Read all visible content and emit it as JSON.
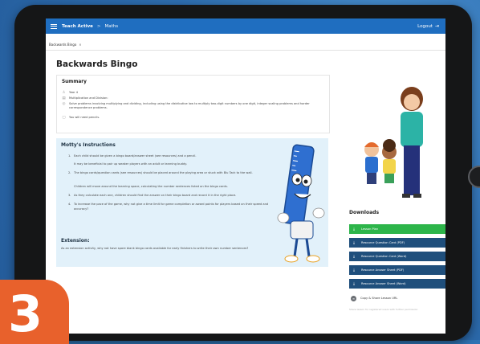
{
  "nav": {
    "brand": "Teach Active",
    "separator": ">",
    "crumb": "Maths",
    "logout_label": "Logout"
  },
  "tab": {
    "label": "Backwards Bingo",
    "close": "×"
  },
  "page": {
    "title": "Backwards Bingo"
  },
  "summary": {
    "heading": "Summary",
    "rows": [
      {
        "icon": "person-icon",
        "text": "Year 4"
      },
      {
        "icon": "book-icon",
        "text": "Multiplication and Division:"
      },
      {
        "icon": "target-icon",
        "text": "Solve problems involving multiplying and dividing, including using the distributive law to multiply two-digit numbers by one digit, integer scaling problems and harder correspondence problems."
      },
      {
        "icon": "clipboard-icon",
        "text": "You will need pencils."
      }
    ]
  },
  "instructions": {
    "heading": "Motty's Instructions",
    "steps": [
      {
        "num": "1.",
        "text": "Each child should be given a bingo board/answer sheet (see resources) and a pencil."
      },
      {
        "num": "",
        "text": "It may be beneficial to pair up weaker players with an adult or learning buddy."
      },
      {
        "num": "2.",
        "text": "The bingo cards/question cards (see resources) should be placed around the playing area or stuck with Blu Tack to the wall."
      },
      {
        "num": "",
        "text": "Children will move around the learning space, calculating the number sentences listed on the bingo cards."
      },
      {
        "num": "3.",
        "text": "As they calculate each one, children should find the answer on their bingo board and record it in the right place."
      },
      {
        "num": "4.",
        "text": "To increase the pace of the game, why not give a time limit for game completion or award points for players based on their speed and accuracy?"
      }
    ],
    "extension_heading": "Extension:",
    "extension_text": "As an extension activity, why not have spare blank bingo cards available for early finishers to write their own number sentences?"
  },
  "downloads": {
    "heading": "Downloads",
    "buttons": [
      {
        "label": "Lesson Plan",
        "icon": "download-icon"
      },
      {
        "label": "Resource Question Card (PDF)",
        "icon": "download-icon"
      },
      {
        "label": "Resource Question Card (Word)",
        "icon": "download-icon"
      },
      {
        "label": "Resource Answer Sheet (PDF)",
        "icon": "download-icon"
      },
      {
        "label": "Resource Answer Sheet (Word)",
        "icon": "download-icon"
      }
    ],
    "share_label": "Copy & Share Lesson URL",
    "fine_print": "Share lesson for registered users with further permission"
  },
  "badge": {
    "number": "3"
  },
  "colors": {
    "topbar": "#1f6ec0",
    "primary_download": "#2db54a",
    "download": "#1f4f7c",
    "instructions_bg": "#e2f1fa",
    "badge": "#e8612c"
  }
}
